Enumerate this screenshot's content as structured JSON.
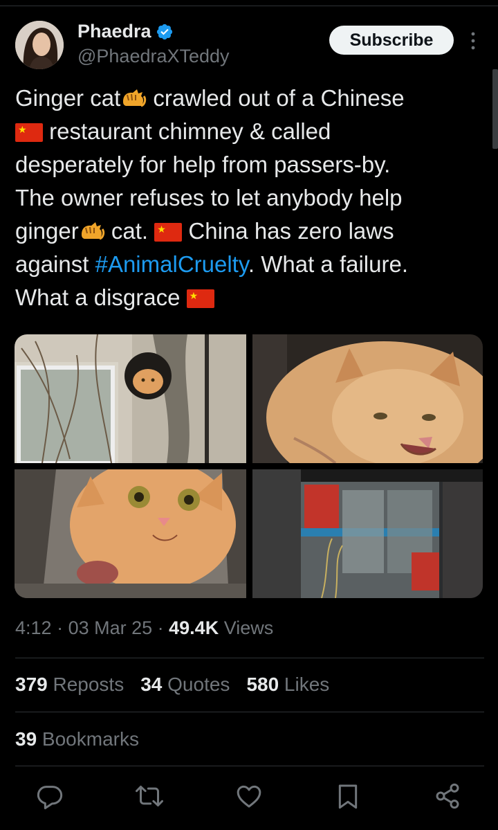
{
  "author": {
    "name": "Phaedra",
    "handle": "@PhaedraXTeddy",
    "verified": true
  },
  "subscribe_label": "Subscribe",
  "tweet": {
    "line1_a": "Ginger cat",
    "line1_b": " crawled out of a Chinese",
    "line2": " restaurant chimney & called",
    "line3": "desperately for help from passers-by.",
    "line4": "The owner refuses to let anybody help",
    "line5_a": "ginger",
    "line5_b": " cat. ",
    "line5_c": " China has zero laws",
    "line6_a": "against ",
    "hashtag": "#AnimalCruelty",
    "line6_b": ". What a failure.",
    "line7": "What a disgrace "
  },
  "meta": {
    "time": "4:12",
    "sep1": " · ",
    "date": "03 Mar 25",
    "sep2": " · ",
    "views_count": "49.4K",
    "views_label": " Views"
  },
  "stats": {
    "reposts_count": "379",
    "reposts_label": " Reposts",
    "quotes_count": "34",
    "quotes_label": " Quotes",
    "likes_count": "580",
    "likes_label": " Likes"
  },
  "bookmarks": {
    "count": "39",
    "label": " Bookmarks"
  },
  "colors": {
    "background": "#000000",
    "text": "#e7e9ea",
    "secondary": "#71767b",
    "accent": "#1d9bf0",
    "divider": "#2f3336"
  },
  "icons": [
    "verified-badge-icon",
    "more-icon",
    "reply-icon",
    "repost-icon",
    "like-icon",
    "bookmark-icon",
    "share-icon"
  ]
}
